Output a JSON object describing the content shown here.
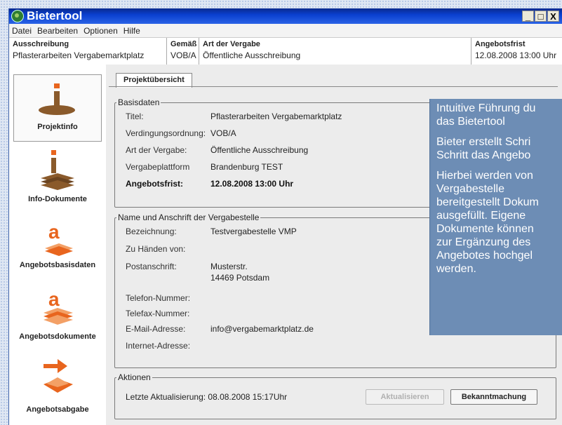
{
  "window": {
    "title": "Bietertool"
  },
  "window_controls": {
    "minimize": "_",
    "maximize": "□",
    "close": "X"
  },
  "menu": [
    "Datei",
    "Bearbeiten",
    "Optionen",
    "Hilfe"
  ],
  "infobar": {
    "ausschreibung_label": "Ausschreibung",
    "ausschreibung_value": "Pflasterarbeiten Vergabemarktplatz",
    "gemaess_label": "Gemäß",
    "gemaess_value": "VOB/A",
    "art_label": "Art der Vergabe",
    "art_value": "Öffentliche Ausschreibung",
    "frist_label": "Angebotsfrist",
    "frist_value": "12.08.2008 13:00 Uhr"
  },
  "sidebar": {
    "items": [
      {
        "label": "Projektinfo",
        "icon": "info-person-icon",
        "active": true
      },
      {
        "label": "Info-Dokumente",
        "icon": "info-documents-icon"
      },
      {
        "label": "Angebotsbasisdaten",
        "icon": "offer-basedata-icon"
      },
      {
        "label": "Angebotsdokumente",
        "icon": "offer-documents-icon"
      },
      {
        "label": "Angebotsabgabe",
        "icon": "offer-submit-icon"
      }
    ]
  },
  "tab": {
    "label": "Projektübersicht"
  },
  "basisdaten": {
    "legend": "Basisdaten",
    "rows": [
      {
        "label": "Titel:",
        "value": "Pflasterarbeiten Vergabemarktplatz"
      },
      {
        "label": "Verdingungsordnung:",
        "value": "VOB/A"
      },
      {
        "label": "Art der Vergabe:",
        "value": "Öffentliche Ausschreibung"
      },
      {
        "label": "Vergabeplattform",
        "value": "Brandenburg TEST"
      },
      {
        "label": "Angebotsfrist:",
        "value": "12.08.2008 13:00 Uhr"
      }
    ]
  },
  "vergabestelle": {
    "legend": "Name und Anschrift der Vergabestelle",
    "rows": [
      {
        "label": "Bezeichnung:",
        "value": "Testvergabestelle VMP"
      },
      {
        "label": "Zu Händen von:",
        "value": ""
      },
      {
        "label": "Postanschrift:",
        "value": "Musterstr."
      },
      {
        "label": "",
        "value": "14469 Potsdam"
      },
      {
        "label": "Telefon-Nummer:",
        "value": ""
      },
      {
        "label": "Telefax-Nummer:",
        "value": ""
      },
      {
        "label": "E-Mail-Adresse:",
        "value": "info@vergabemarktplatz.de"
      },
      {
        "label": "Internet-Adresse:",
        "value": ""
      }
    ]
  },
  "aktionen": {
    "legend": "Aktionen",
    "last_update": "Letzte Aktualisierung: 08.08.2008 15:17Uhr",
    "refresh_button": "Aktualisieren",
    "announcement_button": "Bekanntmachung"
  },
  "callout": {
    "paragraphs": [
      [
        "Intuitive Führung du",
        "das Bietertool"
      ],
      [
        "Bieter erstellt Schri",
        "Schritt das Angebo"
      ],
      [
        "Hierbei werden von",
        "Vergabestelle",
        "bereitgestellt Dokum",
        "ausgefüllt. Eigene",
        "Dokumente können",
        "zur Ergänzung des",
        "Angebotes hochgel",
        "werden."
      ]
    ]
  },
  "colors": {
    "accent_orange": "#e8651e",
    "brown": "#8a5a2b",
    "callout": "#6d8db5",
    "titlebar": "#0a3fcf"
  }
}
